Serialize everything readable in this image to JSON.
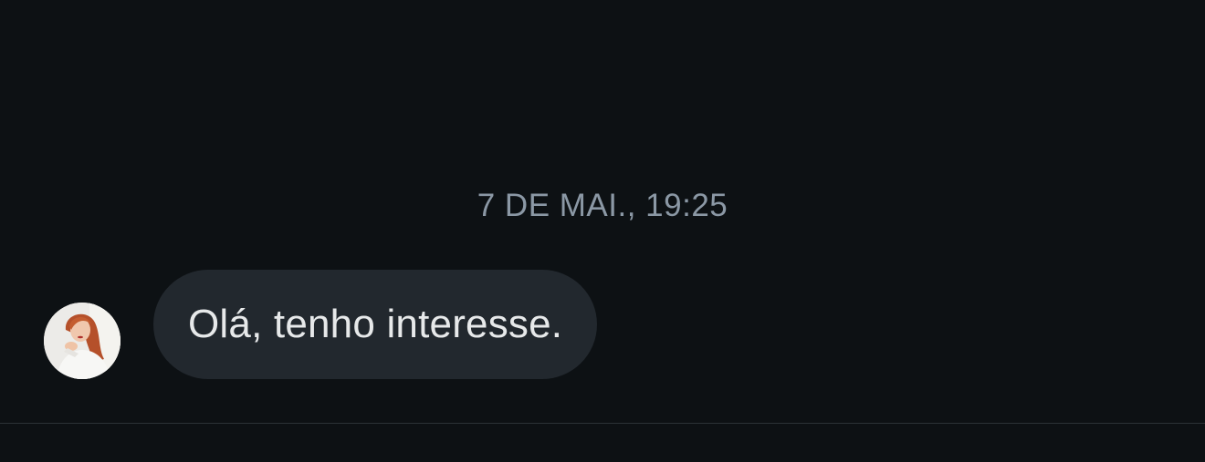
{
  "conversation": {
    "timestamp": "7 DE MAI., 19:25",
    "messages": [
      {
        "text": "Olá, tenho interesse.",
        "avatar_icon": "user-avatar-photo"
      }
    ]
  },
  "colors": {
    "background": "#0d1114",
    "bubble": "#22282e",
    "bubble_text": "#e7e9ea",
    "timestamp": "#8b98a5",
    "divider": "#2c3237"
  }
}
